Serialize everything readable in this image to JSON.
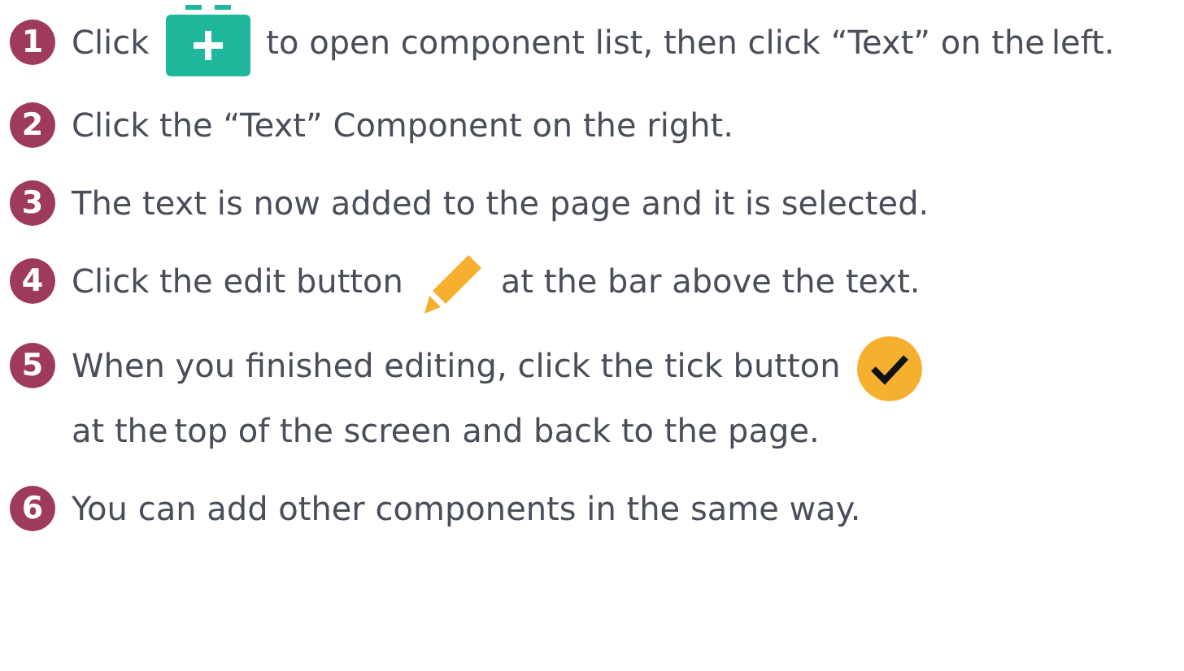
{
  "steps": [
    {
      "number": "1",
      "parts": [
        {
          "kind": "text",
          "text": "Click"
        },
        {
          "kind": "plus"
        },
        {
          "kind": "text",
          "text": "to open component list, then click “Text” on the"
        },
        {
          "kind": "text",
          "text": "left."
        }
      ]
    },
    {
      "number": "2",
      "parts": [
        {
          "kind": "text",
          "text": "Click the “Text” Component on the right."
        }
      ]
    },
    {
      "number": "3",
      "parts": [
        {
          "kind": "text",
          "text": "The text is now added to the page and it is selected."
        }
      ]
    },
    {
      "number": "4",
      "parts": [
        {
          "kind": "text",
          "text": "Click the edit button"
        },
        {
          "kind": "pencil"
        },
        {
          "kind": "text",
          "text": "at the bar above the text."
        }
      ]
    },
    {
      "number": "5",
      "parts": [
        {
          "kind": "text",
          "text": "When you finished editing, click the tick button"
        },
        {
          "kind": "tick"
        },
        {
          "kind": "text",
          "text": "at the"
        },
        {
          "kind": "text",
          "text": "top of the screen and back to the page."
        }
      ]
    },
    {
      "number": "6",
      "parts": [
        {
          "kind": "text",
          "text": "You can add  other components in the same way."
        }
      ]
    }
  ]
}
